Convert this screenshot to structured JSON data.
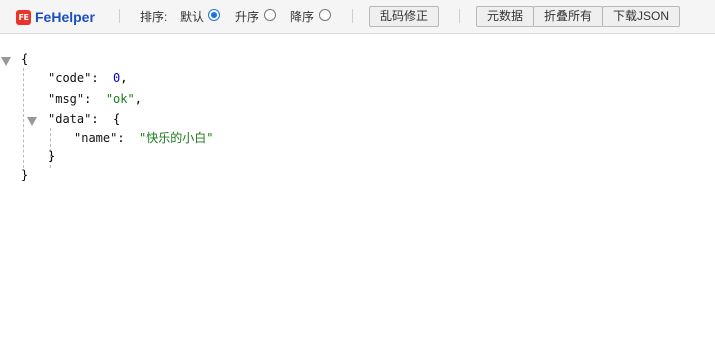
{
  "toolbar": {
    "logo_badge": "FE",
    "app_name": "FeHelper",
    "sort_label": "排序:",
    "sort_options": [
      "默认",
      "升序",
      "降序"
    ],
    "sort_selected": "默认",
    "fix_encoding_button": "乱码修正",
    "metadata_button": "元数据",
    "collapse_all_button": "折叠所有",
    "download_button": "下载JSON"
  },
  "json_view": {
    "open_brace": "{",
    "close_brace": "}",
    "code_key": "\"code\"",
    "code_value": "0",
    "msg_key": "\"msg\"",
    "msg_value": "\"ok\"",
    "data_key": "\"data\"",
    "name_key": "\"name\"",
    "name_value": "\"快乐的小白\"",
    "colon": ":",
    "comma": ","
  }
}
